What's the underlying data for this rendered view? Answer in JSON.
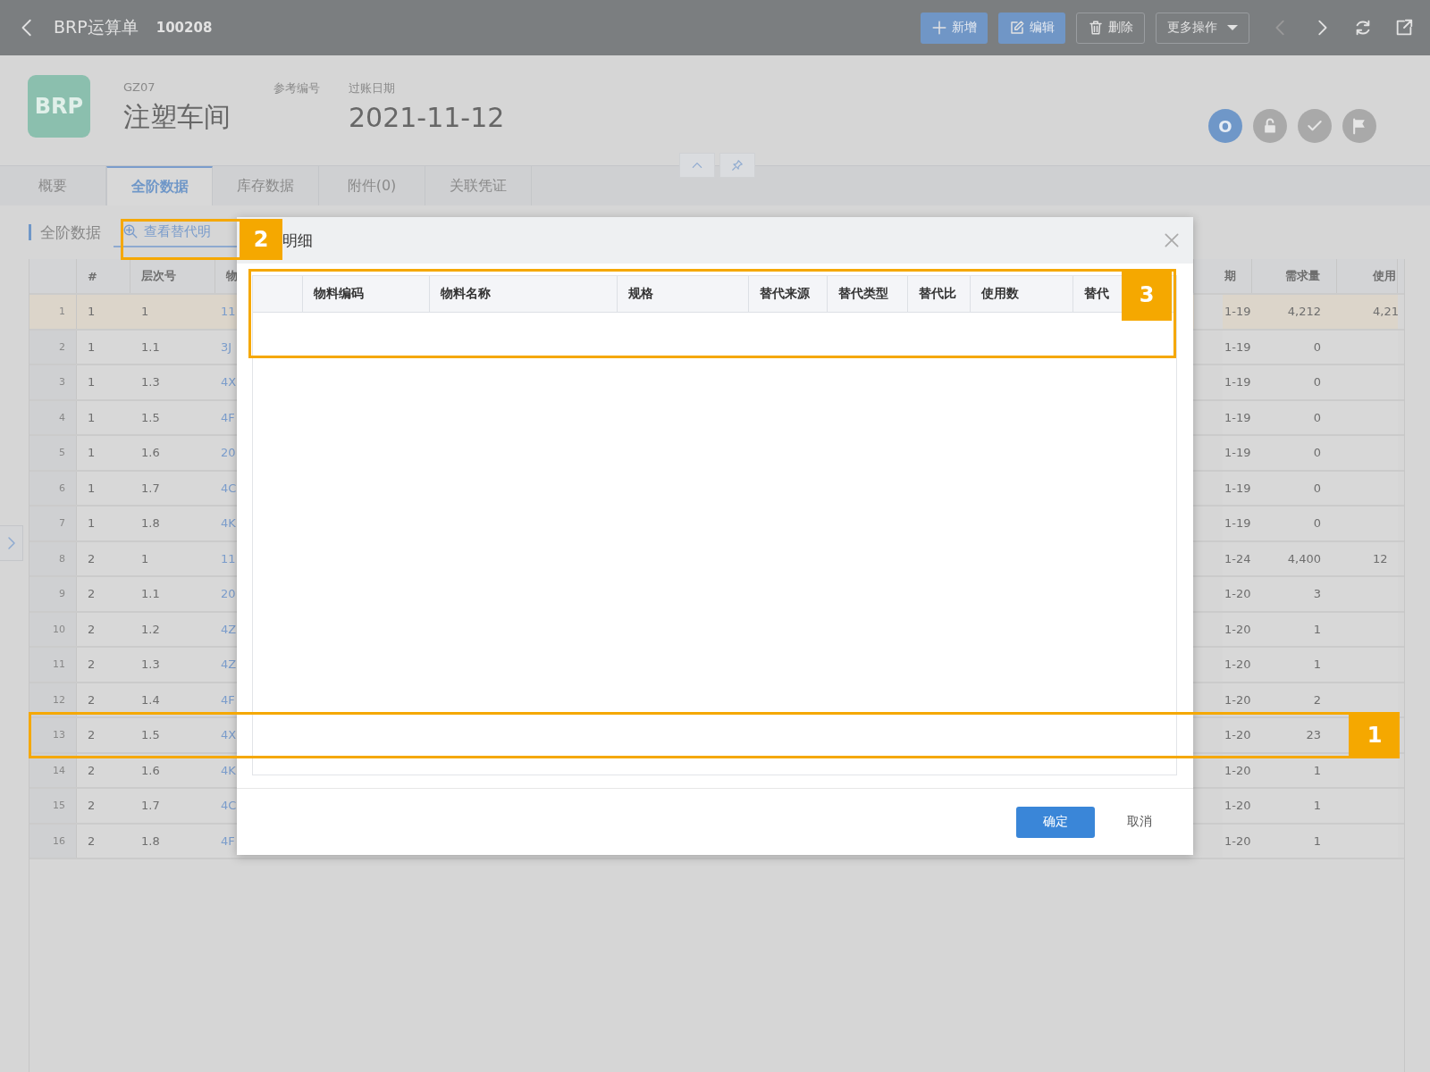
{
  "top_bar": {
    "title": "BRP运算单",
    "doc_number": "100208",
    "buttons": [
      {
        "label": "新增",
        "kind": "add"
      },
      {
        "label": "编辑",
        "kind": "edit"
      },
      {
        "label": "删除",
        "kind": "delete"
      },
      {
        "label": "更多操作",
        "kind": "dropdown"
      }
    ]
  },
  "header": {
    "logo": "BRP",
    "code": "GZ07",
    "name": "注塑车间",
    "ref_label": "参考编号",
    "date_label": "过账日期",
    "date": "2021-11-12",
    "status_icons": [
      {
        "kind": "letter",
        "label": "O",
        "selected": true
      },
      {
        "kind": "lock",
        "selected": false
      },
      {
        "kind": "check",
        "selected": false
      },
      {
        "kind": "flag",
        "selected": false
      }
    ]
  },
  "tabs": [
    {
      "label": "概要",
      "selected": false
    },
    {
      "label": "全阶数据",
      "selected": true
    },
    {
      "label": "库存数据",
      "selected": false
    },
    {
      "label": "附件(0)",
      "selected": false
    },
    {
      "label": "关联凭证",
      "selected": false
    }
  ],
  "section": {
    "title": "全阶数据",
    "action": "查看替代明"
  },
  "table": {
    "columns": [
      "#",
      "层次号",
      "物",
      "期",
      "需求量",
      "使用"
    ],
    "rows": [
      {
        "number": "1",
        "selected": true,
        "cells": [
          "1",
          "1",
          "11",
          "1-19",
          "4,212",
          "4,21"
        ]
      },
      {
        "number": "2",
        "selected": false,
        "cells": [
          "1",
          "1.1",
          "3J",
          "1-19",
          "0"
        ]
      },
      {
        "number": "3",
        "selected": false,
        "cells": [
          "1",
          "1.3",
          "4X",
          "1-19",
          "0"
        ]
      },
      {
        "number": "4",
        "selected": false,
        "cells": [
          "1",
          "1.5",
          "4F",
          "1-19",
          "0"
        ]
      },
      {
        "number": "5",
        "selected": false,
        "cells": [
          "1",
          "1.6",
          "20",
          "1-19",
          "0"
        ]
      },
      {
        "number": "6",
        "selected": false,
        "cells": [
          "1",
          "1.7",
          "4C",
          "1-19",
          "0"
        ]
      },
      {
        "number": "7",
        "selected": false,
        "cells": [
          "1",
          "1.8",
          "4K",
          "1-19",
          "0"
        ]
      },
      {
        "number": "8",
        "selected": false,
        "cells": [
          "2",
          "1",
          "11",
          "1-24",
          "4,400",
          "12"
        ]
      },
      {
        "number": "9",
        "selected": false,
        "cells": [
          "2",
          "1.1",
          "20",
          "1-20",
          "3"
        ]
      },
      {
        "number": "10",
        "selected": false,
        "cells": [
          "2",
          "1.2",
          "4Z",
          "1-20",
          "1"
        ]
      },
      {
        "number": "11",
        "selected": false,
        "cells": [
          "2",
          "1.3",
          "4Z",
          "1-20",
          "1"
        ]
      },
      {
        "number": "12",
        "selected": false,
        "cells": [
          "2",
          "1.4",
          "4F",
          "1-20",
          "2"
        ]
      },
      {
        "number": "13",
        "selected": false,
        "cells": [
          "2",
          "1.5",
          "4X",
          "1-20",
          "23"
        ]
      },
      {
        "number": "14",
        "selected": false,
        "cells": [
          "2",
          "1.6",
          "4K",
          "1-20",
          "1"
        ]
      },
      {
        "number": "15",
        "selected": false,
        "cells": [
          "2",
          "1.7",
          "4C",
          "1-20",
          "1"
        ]
      },
      {
        "number": "16",
        "selected": false,
        "cells": [
          "2",
          "1.8",
          "4F",
          "1-20",
          "1"
        ]
      }
    ]
  },
  "dialog": {
    "title": "明细",
    "columns": [
      "物料编码",
      "物料名称",
      "规格",
      "替代来源",
      "替代类型",
      "替代比",
      "使用数",
      "替代"
    ],
    "buttons": [
      {
        "label": "确定",
        "kind": "primary"
      },
      {
        "label": "取消",
        "kind": "text"
      }
    ]
  },
  "annotations": [
    {
      "label": "1"
    },
    {
      "label": "2"
    },
    {
      "label": "3"
    }
  ]
}
